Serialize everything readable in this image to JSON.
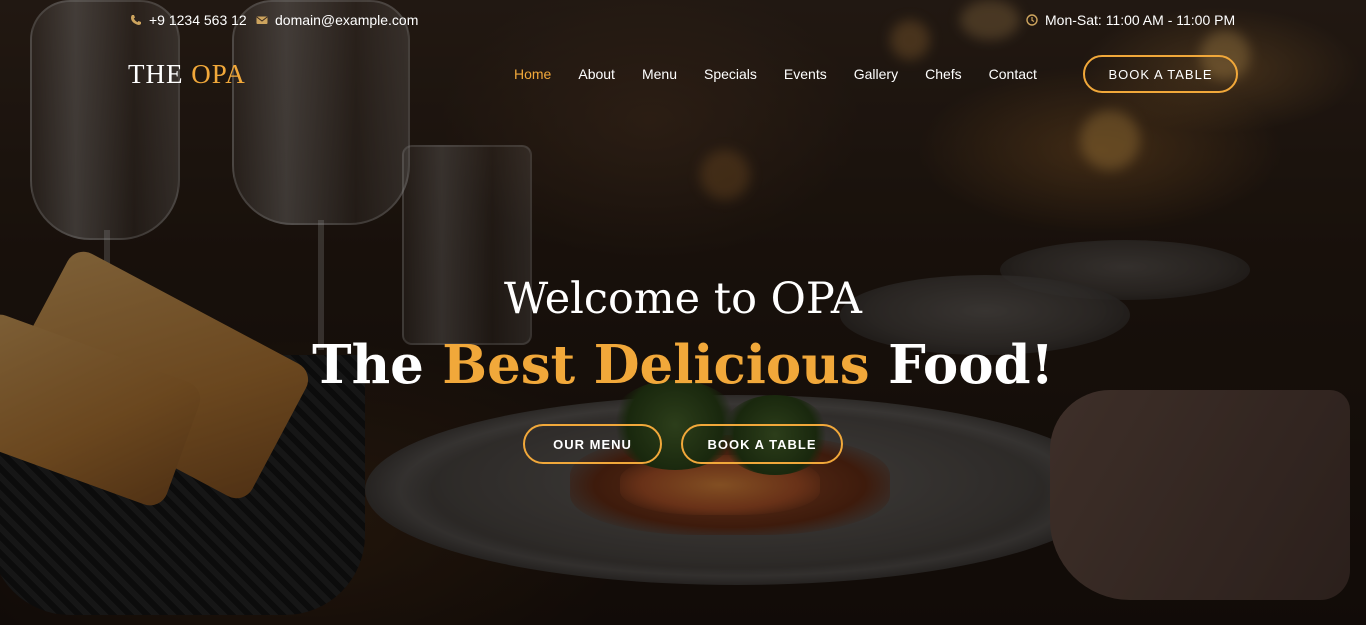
{
  "topbar": {
    "phone_icon": "phone-icon",
    "phone": "+9 1234 563 12",
    "mail_icon": "envelope-icon",
    "email": "domain@example.com",
    "clock_icon": "clock-icon",
    "hours": "Mon-Sat: 11:00 AM - 11:00 PM"
  },
  "header": {
    "logo_part1": "THE",
    "logo_part2": "OPA",
    "nav": [
      {
        "label": "Home",
        "active": true
      },
      {
        "label": "About"
      },
      {
        "label": "Menu"
      },
      {
        "label": "Specials"
      },
      {
        "label": "Events"
      },
      {
        "label": "Gallery"
      },
      {
        "label": "Chefs"
      },
      {
        "label": "Contact"
      }
    ],
    "book_button": "BOOK A TABLE"
  },
  "hero": {
    "title": "Welcome to OPA",
    "subtitle_before": "The",
    "subtitle_accent": "Best Delicious",
    "subtitle_after": "Food!",
    "button_menu": "OUR MENU",
    "button_table": "BOOK A TABLE"
  },
  "colors": {
    "accent": "#f1a83a",
    "text": "#ffffff"
  }
}
